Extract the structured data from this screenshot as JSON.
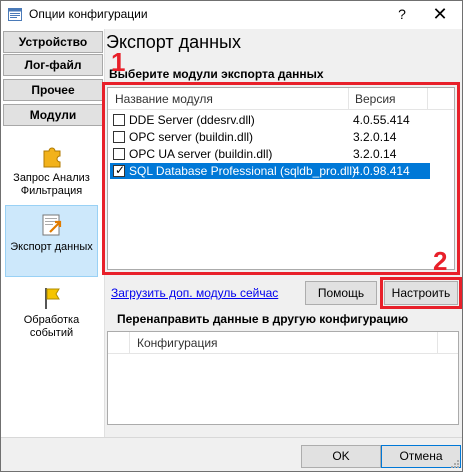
{
  "window": {
    "title": "Опции конфигурации",
    "help_label": "?",
    "close_label": "✕"
  },
  "sidebar": {
    "tabs": [
      {
        "label": "Устройство"
      },
      {
        "label": "Лог-файл"
      },
      {
        "label": "Прочее"
      },
      {
        "label": "Модули"
      }
    ],
    "items": [
      {
        "label": "Запрос Анализ Фильтрация",
        "icon": "puzzle-icon"
      },
      {
        "label": "Экспорт данных",
        "icon": "export-icon"
      },
      {
        "label": "Обработка событий",
        "icon": "flag-icon"
      }
    ]
  },
  "main": {
    "heading": "Экспорт данных",
    "modules_label": "Выберите модули экспорта данных",
    "columns": {
      "name": "Название модуля",
      "version": "Версия"
    },
    "modules": [
      {
        "name": "DDE Server (ddesrv.dll)",
        "version": "4.0.55.414",
        "checked": false
      },
      {
        "name": "OPC server (buildin.dll)",
        "version": "3.2.0.14",
        "checked": false
      },
      {
        "name": "OPC UA server (buildin.dll)",
        "version": "3.2.0.14",
        "checked": false
      },
      {
        "name": "SQL Database Professional (sqldb_pro.dll)",
        "version": "4.0.98.414",
        "checked": true
      }
    ],
    "load_link": "Загрузить доп. модуль сейчас",
    "help_button": "Помощь",
    "configure_button": "Настроить",
    "redirect_label": "Перенаправить данные в другую конфигурацию",
    "config_column": "Конфигурация"
  },
  "annotations": {
    "marker_1": "1",
    "marker_2": "2",
    "color": "#e8202a"
  },
  "footer": {
    "ok": "OK",
    "cancel": "Отмена"
  },
  "colors": {
    "selection": "#0078d7",
    "link": "#0000ee"
  }
}
